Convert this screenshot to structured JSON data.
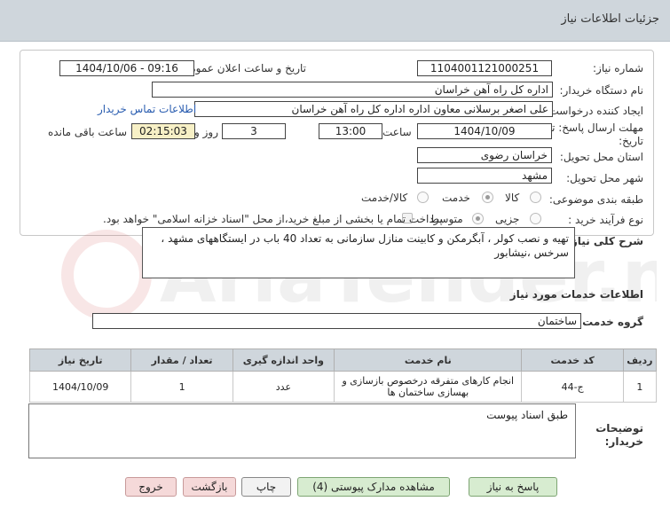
{
  "header": {
    "title": "جزئیات اطلاعات نیاز"
  },
  "form": {
    "need_number_label": "شماره نیاز:",
    "need_number": "1104001121000251",
    "announce_label": "تاریخ و ساعت اعلان عمومی:",
    "announce_value": "1404/10/06 - 09:16",
    "buyer_org_label": "نام دستگاه خریدار:",
    "buyer_org": "اداره کل راه آهن خراسان",
    "creator_label": "ایجاد کننده درخواست:",
    "creator": "علی اصغر برسلانی معاون اداره اداره کل راه آهن خراسان",
    "contact_link": "اطلاعات تماس خریدار",
    "deadline_label": "مهلت ارسال پاسخ: تا تاریخ:",
    "deadline_date": "1404/10/09",
    "time_label": "ساعت",
    "deadline_time": "13:00",
    "days_value": "3",
    "days_label": "روز و",
    "remaining_time": "02:15:03",
    "remaining_label": "ساعت باقی مانده",
    "province_label": "استان محل تحویل:",
    "province": "خراسان رضوی",
    "city_label": "شهر محل تحویل:",
    "city": "مشهد",
    "category_label": "طبقه بندی موضوعی:",
    "category_options": [
      "کالا",
      "خدمت",
      "کالا/خدمت"
    ],
    "process_label": "نوع فرآیند خرید :",
    "process_options": [
      "جزیی",
      "متوسط"
    ],
    "payment_note": "پرداخت تمام یا بخشی از مبلغ خرید،از محل \"اسناد خزانه اسلامی\" خواهد بود."
  },
  "summary": {
    "label": "شرح کلی نیاز:",
    "text": "تهیه و نصب کولر ، آبگرمکن و کابینت منازل سازمانی به تعداد 40 باب در ایستگاههای مشهد ، سرخس ،نیشابور"
  },
  "services": {
    "section_title": "اطلاعات خدمات مورد نیاز",
    "group_label": "گروه خدمت:",
    "group_value": "ساختمان",
    "columns": [
      "ردیف",
      "کد خدمت",
      "نام خدمت",
      "واحد اندازه گیری",
      "تعداد / مقدار",
      "تاریخ نیاز"
    ],
    "rows": [
      {
        "row": "1",
        "code": "ج-44",
        "name": "انجام کارهای متفرقه درخصوص بازسازی و بهسازی ساختمان ها",
        "unit": "عدد",
        "qty": "1",
        "date": "1404/10/09"
      }
    ]
  },
  "notes": {
    "label": "توضیحات خریدار:",
    "text": "طبق اسناد پیوست"
  },
  "buttons": {
    "reply": "پاسخ به نیاز",
    "attachments": "مشاهده مدارک پیوستی (4)",
    "print": "چاپ",
    "back": "بازگشت",
    "exit": "خروج"
  },
  "watermark": {
    "text": "AriaTender.net"
  },
  "colors": {
    "header_bg": "#cfd6dc",
    "link": "#2a5db0",
    "highlight": "#f7f0c6",
    "button_green": "#d7ecd0",
    "button_pink": "#f5d9d9"
  }
}
